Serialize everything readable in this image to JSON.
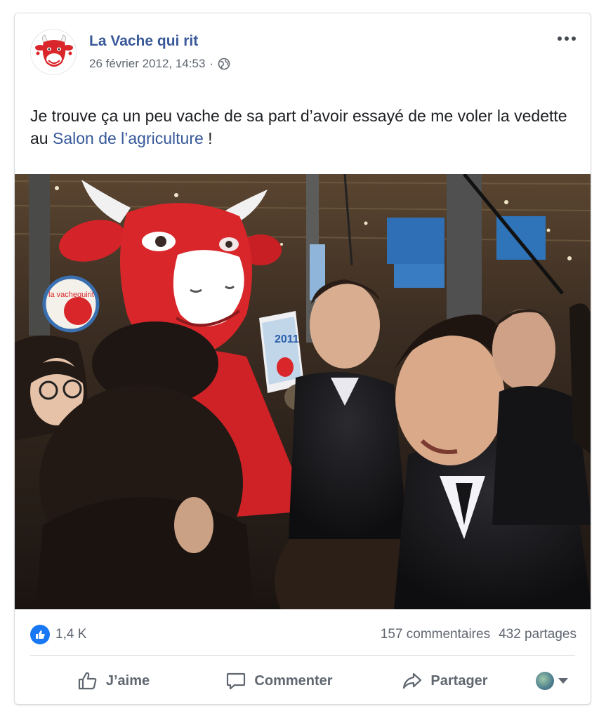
{
  "post": {
    "page_name": "La Vache qui rit",
    "date": "26 février 2012, 14:53",
    "separator": "·",
    "audience_icon": "globe-icon",
    "text_before": "Je trouve ça un peu vache de sa part d’avoir essayé de me voler la vedette au ",
    "link_text": "Salon de l’agriculture",
    "text_after": " !"
  },
  "stats": {
    "reactions_count": "1,4 K",
    "comments": "157 commentaires",
    "shares": "432 partages"
  },
  "actions": {
    "like": "J’aime",
    "comment": "Commenter",
    "share": "Partager"
  },
  "photo": {
    "mascot_badge_text": "la vachequirit",
    "book_text": "2011"
  },
  "colors": {
    "link": "#385898",
    "brand_red": "#d9262a",
    "like_blue": "#1877f2",
    "muted": "#606770"
  }
}
